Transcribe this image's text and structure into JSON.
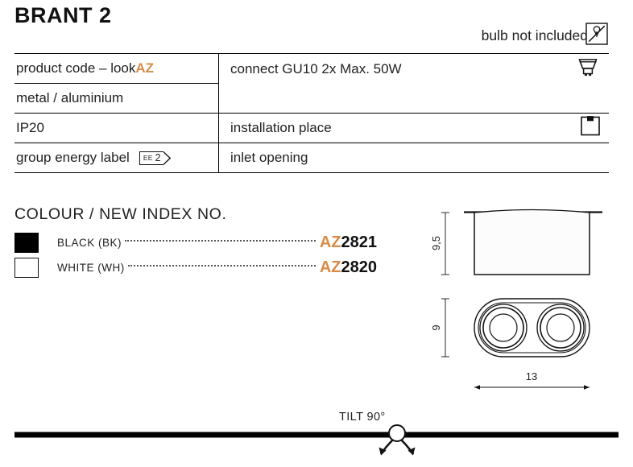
{
  "header": {
    "title": "BRANT 2",
    "bulb_note": "bulb not included",
    "bulb_note_icon": "bulb-crossed-out-icon"
  },
  "accent_color": "#d88b46",
  "spec_table": {
    "rows": [
      {
        "left": "product code – look ",
        "left_accent": "AZ",
        "right": "connect GU10 2x Max. 50W",
        "icon": "gu10-bulb-icon"
      },
      {
        "left": "metal / aluminium",
        "right": "",
        "icon": ""
      },
      {
        "left": "IP20",
        "right": "installation place",
        "icon": "ceiling-mount-icon"
      },
      {
        "left": "group energy label",
        "badge": {
          "prefix": "EE",
          "value": "2"
        },
        "right": "inlet opening",
        "icon": ""
      }
    ]
  },
  "colour_section": {
    "heading": "COLOUR / NEW INDEX NO.",
    "items": [
      {
        "swatch": "black",
        "name": "BLACK (BK)",
        "code_prefix": "AZ",
        "code_number": "2821"
      },
      {
        "swatch": "white",
        "name": "WHITE (WH)",
        "code_prefix": "AZ",
        "code_number": "2820"
      }
    ]
  },
  "tech_drawing": {
    "height_side": "9,5",
    "height_bottom": "9",
    "width_bottom": "13"
  },
  "tilt": {
    "label": "TILT 90°"
  }
}
